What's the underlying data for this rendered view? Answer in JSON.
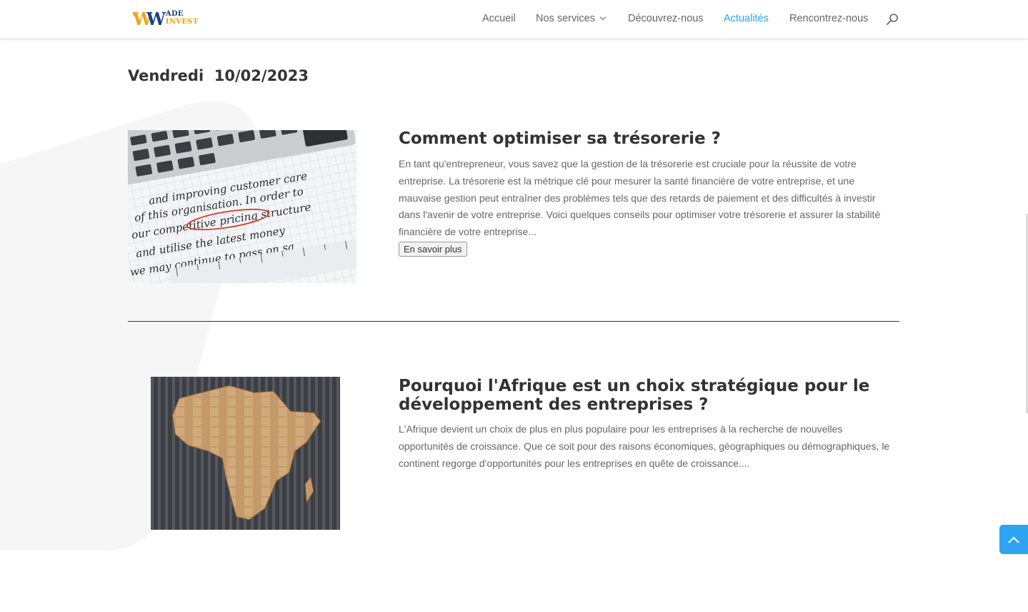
{
  "brand": {
    "logo_letter": "W",
    "logo_text": "ADE",
    "logo_text2": "INVEST"
  },
  "nav": {
    "items": [
      {
        "label": "Accueil"
      },
      {
        "label": "Nos services"
      },
      {
        "label": "Découvrez-nous"
      },
      {
        "label": "Actualités"
      },
      {
        "label": "Rencontrez-nous"
      }
    ],
    "active": "Actualités"
  },
  "page": {
    "date": "Vendredi  10/02/2023"
  },
  "posts": [
    {
      "title": "Comment optimiser sa trésorerie ?",
      "excerpt": "En tant qu'entrepreneur, vous savez que la gestion de la trésorerie est cruciale pour la réussite de votre entreprise. La trésorerie est la métrique clé pour mesurer la santé financière de votre entreprise, et une mauvaise gestion peut entraîner des problèmes tels que des retards de paiement et des difficultés à investir dans l'avenir de votre entreprise. Voici quelques conseils pour optimiser votre trésorerie et assurer la stabilité financière de votre entreprise...",
      "more_label": "En savoir plus",
      "image_text": [
        "and improving customer care",
        "of this organisation. In order to",
        "our competitive pricing structure",
        "and utilise the latest money",
        "we may continue to pass on sa"
      ]
    },
    {
      "title": "Pourquoi l'Afrique est un choix stratégique pour le développement des entreprises ?",
      "excerpt": "L'Afrique devient un choix de plus en plus populaire pour les entreprises à la recherche de nouvelles opportunités de croissance. Que ce soit pour des raisons économiques, géographiques ou démographiques, le continent regorge d'opportunités pour les entreprises en quête de croissance...."
    }
  ],
  "colors": {
    "accent": "#2ea3f2",
    "brand_blue": "#1e3f8a",
    "brand_orange": "#f2a516",
    "bg_shape": "#f7f7f7"
  }
}
